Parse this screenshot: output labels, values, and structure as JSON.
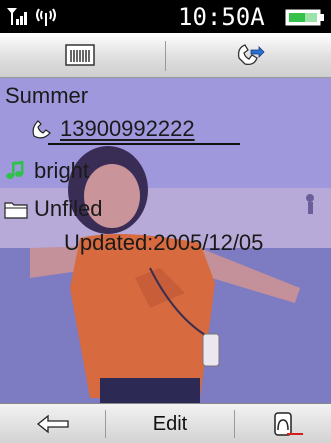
{
  "status_bar": {
    "time": "10:50A",
    "signal_icon": "signal-strength-icon",
    "bluetooth_icon": "antenna-icon",
    "battery_icon": "battery-icon"
  },
  "toolbar": {
    "left_icon": "memory-card-icon",
    "right_icon": "call-forward-icon"
  },
  "contact": {
    "name": "Summer",
    "phone": "13900992222",
    "ringtone": "bright",
    "group": "Unfiled",
    "updated": "Updated:2005/12/05"
  },
  "softkeys": {
    "left_icon": "back-arrow-icon",
    "middle": "Edit",
    "right_icon": "contact-card-icon"
  },
  "colors": {
    "accent_red": "#d81c1c",
    "overlay": "#8f8fd6"
  }
}
